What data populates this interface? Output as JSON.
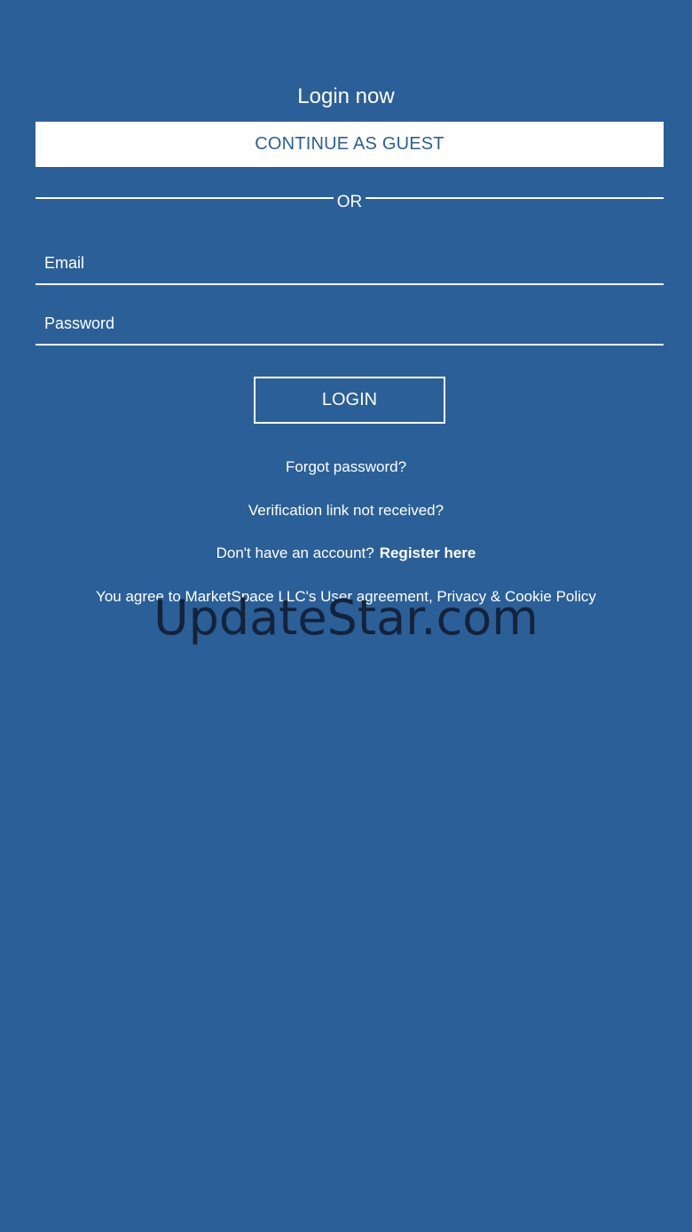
{
  "login": {
    "title": "Login now",
    "guest_button": "CONTINUE AS GUEST",
    "divider_text": "OR",
    "email_placeholder": "Email",
    "email_value": "",
    "password_placeholder": "Password",
    "password_value": "",
    "login_button": "LOGIN",
    "forgot_password": "Forgot password?",
    "verification_link": "Verification link not received?",
    "no_account_text": "Don't have an account?",
    "register_link": "Register here",
    "agreement_text": "You agree to MarketSpace LLC's User agreement, Privacy & Cookie Policy"
  },
  "watermark": {
    "text": "UpdateStar.com"
  },
  "colors": {
    "background": "#2b5f98",
    "primary_text": "#ffffff",
    "guest_button_text": "#2b5f98",
    "watermark": "#14233a"
  }
}
